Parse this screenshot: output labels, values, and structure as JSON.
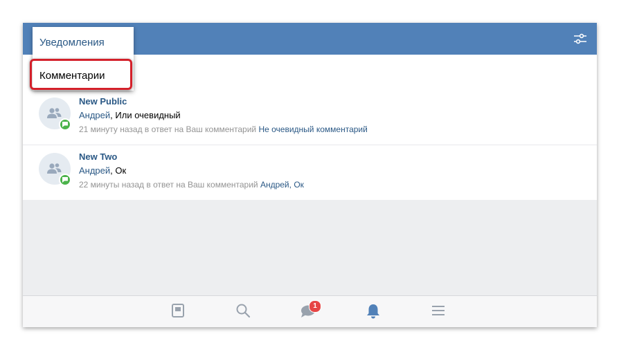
{
  "header": {
    "filter_icon": "sliders-icon",
    "background": "#5181b8"
  },
  "dropdown": {
    "items": [
      {
        "label": "Уведомления"
      },
      {
        "label": "Комментарии"
      }
    ]
  },
  "feed": [
    {
      "title": "New Public",
      "author": "Андрей",
      "separator": ", ",
      "text": "Или очевидный",
      "time": "21 минуту назад в ответ на Ваш комментарий",
      "reply_link": "Не очевидный комментарий"
    },
    {
      "title": "New Two",
      "author": "Андрей",
      "separator": ", ",
      "text": "Ок",
      "time": "22 минуты назад в ответ на Ваш комментарий",
      "reply_author": "Андрей",
      "reply_sep": ", ",
      "reply_text": "Ок"
    }
  ],
  "bottom_nav": {
    "items": [
      "news-icon",
      "search-icon",
      "messages-icon",
      "notifications-icon",
      "menu-icon"
    ],
    "messages_badge": "1"
  },
  "colors": {
    "accent": "#5181b8",
    "link": "#2a5885",
    "badge": "#e64646",
    "comment_badge": "#4bb34b",
    "highlight": "#d4202a"
  }
}
